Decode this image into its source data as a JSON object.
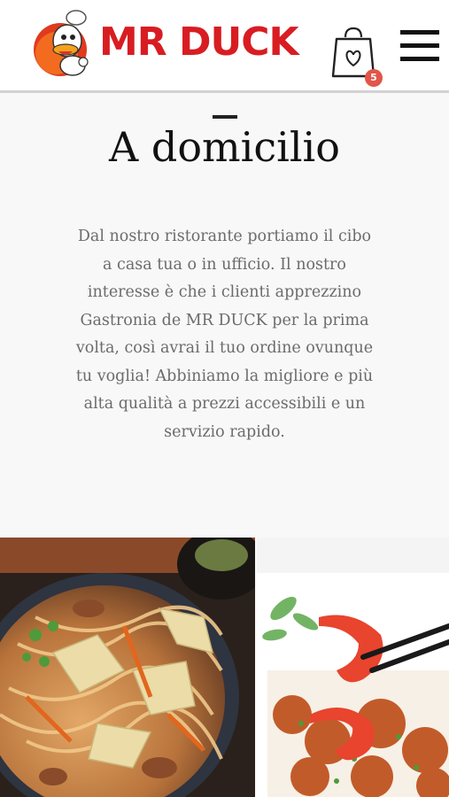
{
  "header": {
    "brand_name": "MR DUCK",
    "cart_count": "5",
    "cart_icon": "shopping-bag-heart-icon",
    "menu_icon": "hamburger-menu-icon",
    "brand_color": "#d81d22"
  },
  "main": {
    "title": "A domicilio",
    "description": "Dal nostro ristorante portiamo il cibo a casa tua o in ufficio. Il nostro interesse è che i clienti apprezzino Gastronia de MR DUCK per la prima volta, così avrai il tuo ordine ovunque tu voglia! Abbiniamo la migliore e più alta qualità a prezzi accessibili e un servizio rapido."
  },
  "images": [
    {
      "name": "stir-fried-noodles-photo"
    },
    {
      "name": "shrimp-dish-photo"
    }
  ]
}
